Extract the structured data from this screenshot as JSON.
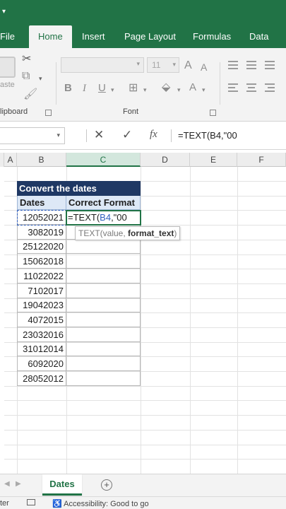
{
  "title_bar": {
    "qa_icon": "dropdown-caret-icon"
  },
  "ribbon_tabs": [
    {
      "label": "File",
      "active": false
    },
    {
      "label": "Home",
      "active": true
    },
    {
      "label": "Insert",
      "active": false
    },
    {
      "label": "Page Layout",
      "active": false
    },
    {
      "label": "Formulas",
      "active": false
    },
    {
      "label": "Data",
      "active": false
    }
  ],
  "ribbon": {
    "clipboard": {
      "paste_label": "aste",
      "group_label": "lipboard",
      "cut_icon": "scissors-icon",
      "copy_icon": "copy-icon",
      "format_painter_icon": "paintbrush-icon"
    },
    "font": {
      "group_label": "Font",
      "font_name": "",
      "font_size": "11",
      "increase_icon": "A",
      "decrease_icon": "A",
      "bold": "B",
      "italic": "I",
      "underline": "U"
    }
  },
  "formula_bar": {
    "name_box": "",
    "cancel_icon": "✕",
    "enter_icon": "✓",
    "fx_label": "fx",
    "formula": "=TEXT(B4,\"00"
  },
  "grid": {
    "columns": [
      "A",
      "B",
      "C",
      "D",
      "E",
      "F"
    ],
    "active_column": "C",
    "table_title": "Convert the dates",
    "headers": {
      "dates": "Dates",
      "correct_format": "Correct Format"
    },
    "dates": [
      "12052021",
      "3082019",
      "25122020",
      "15062018",
      "11022022",
      "7102017",
      "19042023",
      "4072015",
      "23032016",
      "31012014",
      "6092020",
      "28052012"
    ],
    "active_cell": {
      "prefix": "=TEXT(",
      "ref": "B4",
      "suffix": ",\"00"
    },
    "tooltip": {
      "fn": "TEXT(value, ",
      "arg": "format_text",
      "close": ")"
    }
  },
  "sheet_tabs": {
    "active_sheet": "Dates",
    "add_label": "+"
  },
  "status_bar": {
    "left": "ter",
    "accessibility": "Accessibility: Good to go"
  },
  "colors": {
    "excel_green": "#217346",
    "title_fill": "#1f3864",
    "header_fill": "#dde8f6",
    "ref_blue": "#2f5fbf"
  }
}
